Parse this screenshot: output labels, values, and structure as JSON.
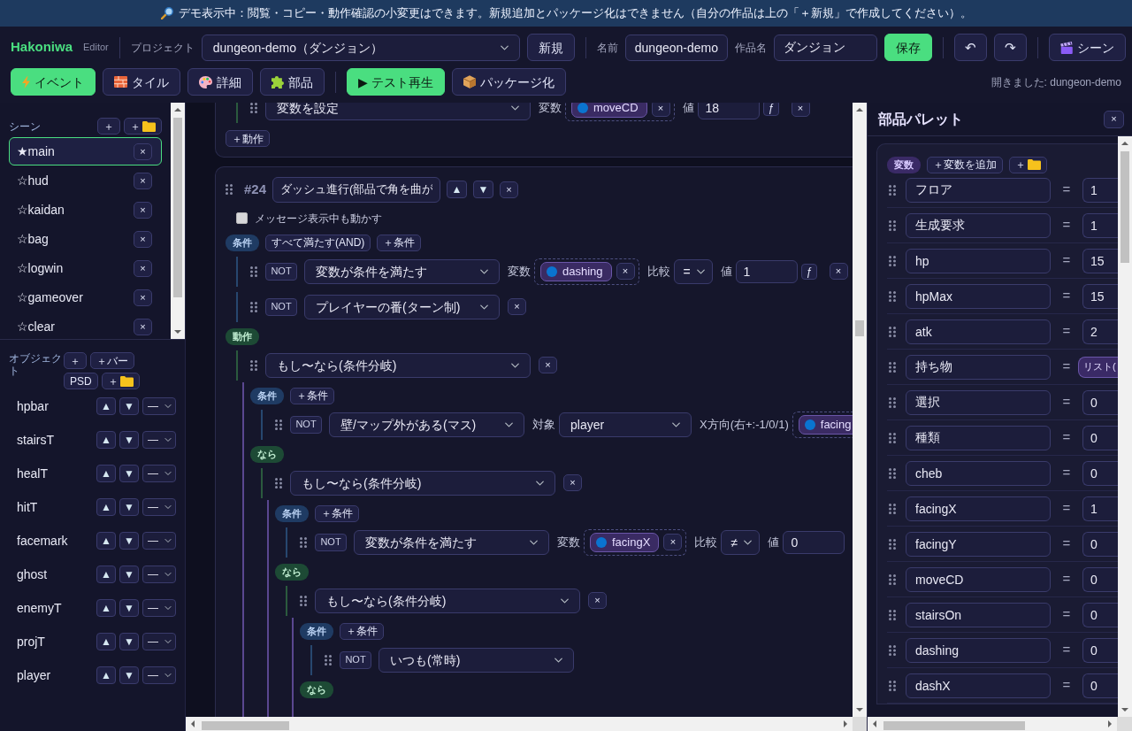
{
  "banner": {
    "text": "デモ表示中：閲覧・コピー・動作確認の小変更はできます。新規追加とパッケージ化はできません（自分の作品は上の「＋新規」で作成してください）。"
  },
  "header": {
    "brand": "Hakoniwa",
    "brand_sub": "Editor",
    "project_label": "プロジェクト",
    "project": "dungeon-demo（ダンジョン）",
    "new_button": "新規",
    "name_label": "名前",
    "name": "dungeon-demo",
    "title_label": "作品名",
    "title": "ダンジョン",
    "save_button": "保存",
    "undo": "↶",
    "redo": "↷",
    "scene_button": "シーン"
  },
  "toolbar": {
    "tabs": [
      {
        "kind": "event",
        "label": "イベント",
        "selected": true
      },
      {
        "kind": "tile",
        "label": "タイル",
        "selected": false
      },
      {
        "kind": "detail",
        "label": "詳細",
        "selected": false
      },
      {
        "kind": "parts",
        "label": "部品",
        "selected": false
      }
    ],
    "play_button": "▶ テスト再生",
    "package_button": "パッケージ化",
    "status": "開きました: dungeon-demo"
  },
  "scenes": {
    "title": "シーン",
    "add": "＋",
    "add_folder": "＋",
    "items": [
      {
        "name": "★main",
        "selected": true,
        "remove": "×"
      },
      {
        "name": "☆hud",
        "selected": false,
        "remove": "×"
      },
      {
        "name": "☆kaidan",
        "selected": false,
        "remove": "×"
      },
      {
        "name": "☆bag",
        "selected": false,
        "remove": "×"
      },
      {
        "name": "☆logwin",
        "selected": false,
        "remove": "×"
      },
      {
        "name": "☆gameover",
        "selected": false,
        "remove": "×"
      },
      {
        "name": "☆clear",
        "selected": false,
        "remove": "×"
      }
    ]
  },
  "objects": {
    "title": "オブジェクト",
    "buttons": [
      {
        "kind": "add",
        "label": "＋"
      },
      {
        "kind": "add",
        "label": "＋バー"
      },
      {
        "kind": "add",
        "label": "PSD"
      },
      {
        "kind": "folder",
        "label": "＋"
      }
    ],
    "items": [
      {
        "name": "hpbar",
        "up": "▲",
        "down": "▼",
        "layer": "—"
      },
      {
        "name": "stairsT",
        "up": "▲",
        "down": "▼",
        "layer": "—"
      },
      {
        "name": "healT",
        "up": "▲",
        "down": "▼",
        "layer": "—"
      },
      {
        "name": "hitT",
        "up": "▲",
        "down": "▼",
        "layer": "—"
      },
      {
        "name": "facemark",
        "up": "▲",
        "down": "▼",
        "layer": "—"
      },
      {
        "name": "ghost",
        "up": "▲",
        "down": "▼",
        "layer": "—"
      },
      {
        "name": "enemyT",
        "up": "▲",
        "down": "▼",
        "layer": "—"
      },
      {
        "name": "projT",
        "up": "▲",
        "down": "▼",
        "layer": "—"
      },
      {
        "name": "player",
        "up": "▲",
        "down": "▼",
        "layer": "—"
      }
    ]
  },
  "events": [
    {
      "actions": [
        {
          "type": "変数を設定",
          "params": [
            {
              "kind": "var",
              "label": "変数",
              "value": "moveCD",
              "remove": "×"
            },
            {
              "kind": "input",
              "label": "値",
              "value": "18",
              "formula": "ƒ"
            }
          ],
          "remove": "×"
        }
      ],
      "add_action": "＋動作"
    },
    {
      "number": "#24",
      "name": "ダッシュ進行(部品で角を曲が",
      "up": "▲",
      "down": "▼",
      "remove": "×",
      "run_during_message": {
        "label": "メッセージ表示中も動かす",
        "checked": false
      },
      "conditions_label": "条件",
      "match_mode": "すべて満たす(AND)",
      "add_condition": "＋条件",
      "conditions": [
        {
          "not": "NOT",
          "type": "変数が条件を満たす",
          "params": [
            {
              "kind": "var",
              "label": "変数",
              "value": "dashing",
              "remove": "×"
            },
            {
              "kind": "select",
              "label": "比較",
              "value": "="
            },
            {
              "kind": "input",
              "label": "値",
              "value": "1",
              "formula": "ƒ"
            }
          ],
          "remove": "×"
        },
        {
          "not": "NOT",
          "type": "プレイヤーの番(ターン制)",
          "remove": "×"
        }
      ],
      "actions_label": "動作",
      "actions": [
        {
          "type": "もし〜なら(条件分岐)",
          "remove": "×",
          "conditions_label": "条件",
          "add_condition": "＋条件",
          "conditions": [
            {
              "not": "NOT",
              "type": "壁/マップ外がある(マス)",
              "params": [
                {
                  "kind": "select",
                  "label": "対象",
                  "value": "player"
                },
                {
                  "kind": "var",
                  "label": "X方向(右+:-1/0/1)",
                  "value": "facing"
                }
              ]
            }
          ],
          "then_label": "なら",
          "then": [
            {
              "type": "もし〜なら(条件分岐)",
              "remove": "×",
              "conditions_label": "条件",
              "add_condition": "＋条件",
              "conditions": [
                {
                  "not": "NOT",
                  "type": "変数が条件を満たす",
                  "params": [
                    {
                      "kind": "var",
                      "label": "変数",
                      "value": "facingX",
                      "remove": "×"
                    },
                    {
                      "kind": "select",
                      "label": "比較",
                      "value": "≠"
                    },
                    {
                      "kind": "input",
                      "label": "値",
                      "value": "0"
                    }
                  ]
                }
              ],
              "then_label": "なら",
              "then": [
                {
                  "type": "もし〜なら(条件分岐)",
                  "remove": "×",
                  "conditions_label": "条件",
                  "add_condition": "＋条件",
                  "conditions": [
                    {
                      "not": "NOT",
                      "type": "いつも(常時)"
                    }
                  ],
                  "then_label": "なら"
                }
              ]
            }
          ]
        }
      ]
    }
  ],
  "palette": {
    "title": "部品パレット",
    "close": "×",
    "section_label": "変数",
    "add_variable": "＋変数を追加",
    "add_folder": "＋",
    "variables": [
      {
        "kind": "number",
        "name": "フロア",
        "equals": "=",
        "value": "1"
      },
      {
        "kind": "number",
        "name": "生成要求",
        "equals": "=",
        "value": "1"
      },
      {
        "kind": "number",
        "name": "hp",
        "equals": "=",
        "value": "15"
      },
      {
        "kind": "number",
        "name": "hpMax",
        "equals": "=",
        "value": "15"
      },
      {
        "kind": "number",
        "name": "atk",
        "equals": "=",
        "value": "2"
      },
      {
        "kind": "list",
        "name": "持ち物",
        "equals": "=",
        "value": "リスト("
      },
      {
        "kind": "number",
        "name": "選択",
        "equals": "=",
        "value": "0"
      },
      {
        "kind": "number",
        "name": "種類",
        "equals": "=",
        "value": "0"
      },
      {
        "kind": "number",
        "name": "cheb",
        "equals": "=",
        "value": "0"
      },
      {
        "kind": "number",
        "name": "facingX",
        "equals": "=",
        "value": "1"
      },
      {
        "kind": "number",
        "name": "facingY",
        "equals": "=",
        "value": "0"
      },
      {
        "kind": "number",
        "name": "moveCD",
        "equals": "=",
        "value": "0"
      },
      {
        "kind": "number",
        "name": "stairsOn",
        "equals": "=",
        "value": "0"
      },
      {
        "kind": "number",
        "name": "dashing",
        "equals": "=",
        "value": "0"
      },
      {
        "kind": "number",
        "name": "dashX",
        "equals": "=",
        "value": "0"
      }
    ]
  }
}
